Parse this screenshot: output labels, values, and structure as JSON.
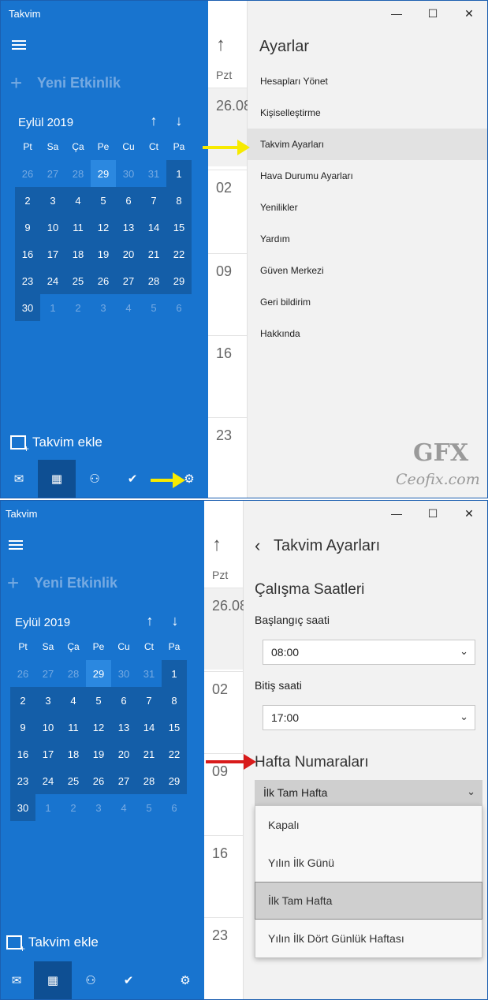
{
  "app_title": "Takvim",
  "new_event_label": "Yeni Etkinlik",
  "month_label": "Eylül 2019",
  "weekdays": [
    "Pt",
    "Sa",
    "Ça",
    "Pe",
    "Cu",
    "Ct",
    "Pa"
  ],
  "weeks": [
    [
      "26",
      "27",
      "28",
      "29",
      "30",
      "31",
      "1"
    ],
    [
      "2",
      "3",
      "4",
      "5",
      "6",
      "7",
      "8"
    ],
    [
      "9",
      "10",
      "11",
      "12",
      "13",
      "14",
      "15"
    ],
    [
      "16",
      "17",
      "18",
      "19",
      "20",
      "21",
      "22"
    ],
    [
      "23",
      "24",
      "25",
      "26",
      "27",
      "28",
      "29"
    ],
    [
      "30",
      "1",
      "2",
      "3",
      "4",
      "5",
      "6"
    ]
  ],
  "add_calendar_label": "Takvim ekle",
  "week_strip": {
    "day_abbrev": "Pzt",
    "dates": [
      "26.08",
      "02",
      "09",
      "16",
      "23"
    ]
  },
  "window_controls": [
    "—",
    "☐",
    "✕"
  ],
  "settings_menu": {
    "title": "Ayarlar",
    "items": [
      "Hesapları Yönet",
      "Kişiselleştirme",
      "Takvim Ayarları",
      "Hava Durumu Ayarları",
      "Yenilikler",
      "Yardım",
      "Güven Merkezi",
      "Geri bildirim",
      "Hakkında"
    ],
    "highlighted": "Takvim Ayarları"
  },
  "calendar_settings": {
    "back_icon": "‹",
    "title": "Takvim Ayarları",
    "working_hours_title": "Çalışma Saatleri",
    "start_label": "Başlangıç saati",
    "start_value": "08:00",
    "end_label": "Bitiş saati",
    "end_value": "17:00",
    "week_numbers_title": "Hafta Numaraları",
    "week_numbers_value": "İlk Tam Hafta",
    "week_numbers_options": [
      "Kapalı",
      "Yılın İlk Günü",
      "İlk Tam Hafta",
      "Yılın İlk Dört Günlük Haftası"
    ]
  },
  "watermark": {
    "logo": "GFX",
    "site": "Ceofix.com"
  },
  "colors": {
    "sidebar": "#1874cf",
    "month_cells": "#145ea8",
    "today": "#2b88e0",
    "yellow_arrow": "#f7ea00",
    "red_arrow": "#d81b1b"
  },
  "icons": {
    "nav": [
      "mail-icon",
      "calendar-icon",
      "people-icon",
      "todo-icon",
      "settings-icon"
    ],
    "chevron": "chevron-down-icon",
    "arrows": [
      "arrow-up-icon",
      "arrow-down-icon"
    ]
  }
}
